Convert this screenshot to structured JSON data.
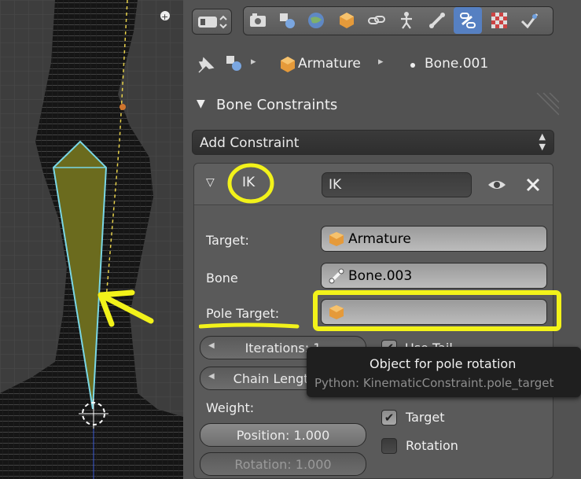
{
  "breadcrumb": {
    "object": "Armature",
    "bone": "Bone.001"
  },
  "section_title": "Bone Constraints",
  "add_constraint": "Add Constraint",
  "constraint": {
    "type_label": "IK",
    "name_value": "IK",
    "target_label": "Target:",
    "target_value": "Armature",
    "bone_label": "Bone",
    "bone_value": "Bone.003",
    "pole_target_label": "Pole Target:",
    "pole_target_value": "",
    "iterations_label": "Iterations: 1",
    "use_tail_label": "Use Tail",
    "chain_length_label": "Chain Length: 0",
    "weight_label": "Weight:",
    "position_label": "Position: 1.000",
    "rotation_weight_label": "Rotation: 1.000",
    "target_checkbox_label": "Target",
    "rotation_checkbox_label": "Rotation"
  },
  "tooltip": {
    "title": "Object for pole rotation",
    "python": "Python: KinematicConstraint.pole_target"
  },
  "colors": {
    "panel_bg": "#525252",
    "field_bg": "#a8a8a8",
    "highlight_yellow": "#f2f21a",
    "active_tab": "#5680c2",
    "bone_fill": "#6b6b1e",
    "bone_outline": "#7ad7e6"
  },
  "icons": [
    "editor-type-icon",
    "render-icon",
    "render-layers-icon",
    "world-icon",
    "object-icon",
    "constraints-icon",
    "data-icon",
    "bone-icon",
    "bone-constraint-icon",
    "texture-icon",
    "vertex-icon"
  ]
}
